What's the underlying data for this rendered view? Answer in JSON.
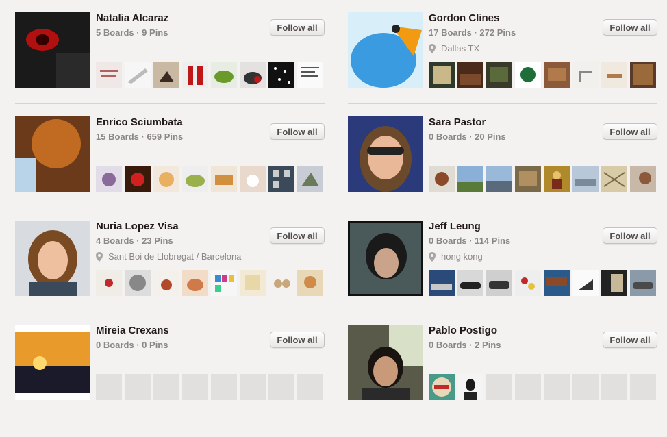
{
  "follow_label": "Follow all",
  "cards": [
    {
      "name": "Natalia Alcaraz",
      "stats": "5 Boards · 9 Pins",
      "location": ""
    },
    {
      "name": "Gordon Clines",
      "stats": "17 Boards · 272 Pins",
      "location": "Dallas TX"
    },
    {
      "name": "Enrico Sciumbata",
      "stats": "15 Boards · 659 Pins",
      "location": ""
    },
    {
      "name": "Sara Pastor",
      "stats": "0 Boards · 20 Pins",
      "location": ""
    },
    {
      "name": "Nuria Lopez Visa",
      "stats": "4 Boards · 23 Pins",
      "location": "Sant Boi de Llobregat / Barcelona"
    },
    {
      "name": "Jeff Leung",
      "stats": "0 Boards · 114 Pins",
      "location": "hong kong"
    },
    {
      "name": "Mireia Crexans",
      "stats": "0 Boards · 0 Pins",
      "location": ""
    },
    {
      "name": "Pablo Postigo",
      "stats": "0 Boards · 2 Pins",
      "location": ""
    }
  ],
  "colors": {
    "background": "#f3f2f0",
    "name_text": "#221919",
    "meta_text": "#8c8787",
    "empty_thumb": "#e2e0de",
    "button_text": "#524d4d"
  }
}
